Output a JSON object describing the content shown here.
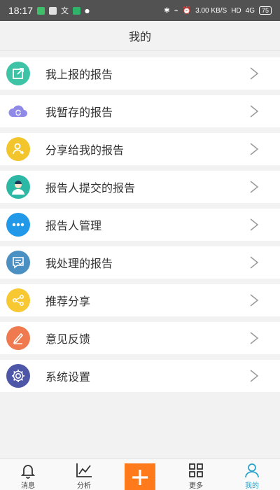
{
  "status_bar": {
    "time": "18:17",
    "speed": "3.00 KB/S",
    "hd": "HD",
    "network": "4G",
    "battery": "75"
  },
  "header": {
    "title": "我的"
  },
  "menu": {
    "items": [
      {
        "label": "我上报的报告",
        "icon": "report-edit-icon",
        "color": "#3fc3a6"
      },
      {
        "label": "我暂存的报告",
        "icon": "cloud-sync-icon",
        "color": "#8f89e8"
      },
      {
        "label": "分享给我的报告",
        "icon": "person-share-icon",
        "color": "#f3c52c"
      },
      {
        "label": "报告人提交的报告",
        "icon": "doctor-icon",
        "color": "#2db8a6"
      },
      {
        "label": "报告人管理",
        "icon": "more-dots-icon",
        "color": "#2199e8"
      },
      {
        "label": "我处理的报告",
        "icon": "chat-check-icon",
        "color": "#4a90c2"
      },
      {
        "label": "推荐分享",
        "icon": "share-icon",
        "color": "#f8c832"
      },
      {
        "label": "意见反馈",
        "icon": "feedback-pen-icon",
        "color": "#f07a4f"
      },
      {
        "label": "系统设置",
        "icon": "settings-gear-icon",
        "color": "#4e56a8"
      }
    ]
  },
  "tab_bar": {
    "tabs": [
      {
        "label": "消息",
        "icon": "bell-icon"
      },
      {
        "label": "分析",
        "icon": "chart-line-icon"
      },
      {
        "label": "",
        "icon": "plus-icon"
      },
      {
        "label": "更多",
        "icon": "grid-icon"
      },
      {
        "label": "我的",
        "icon": "user-icon"
      }
    ],
    "active_color": "#29a4c9",
    "add_color": "#ff7a1a"
  }
}
